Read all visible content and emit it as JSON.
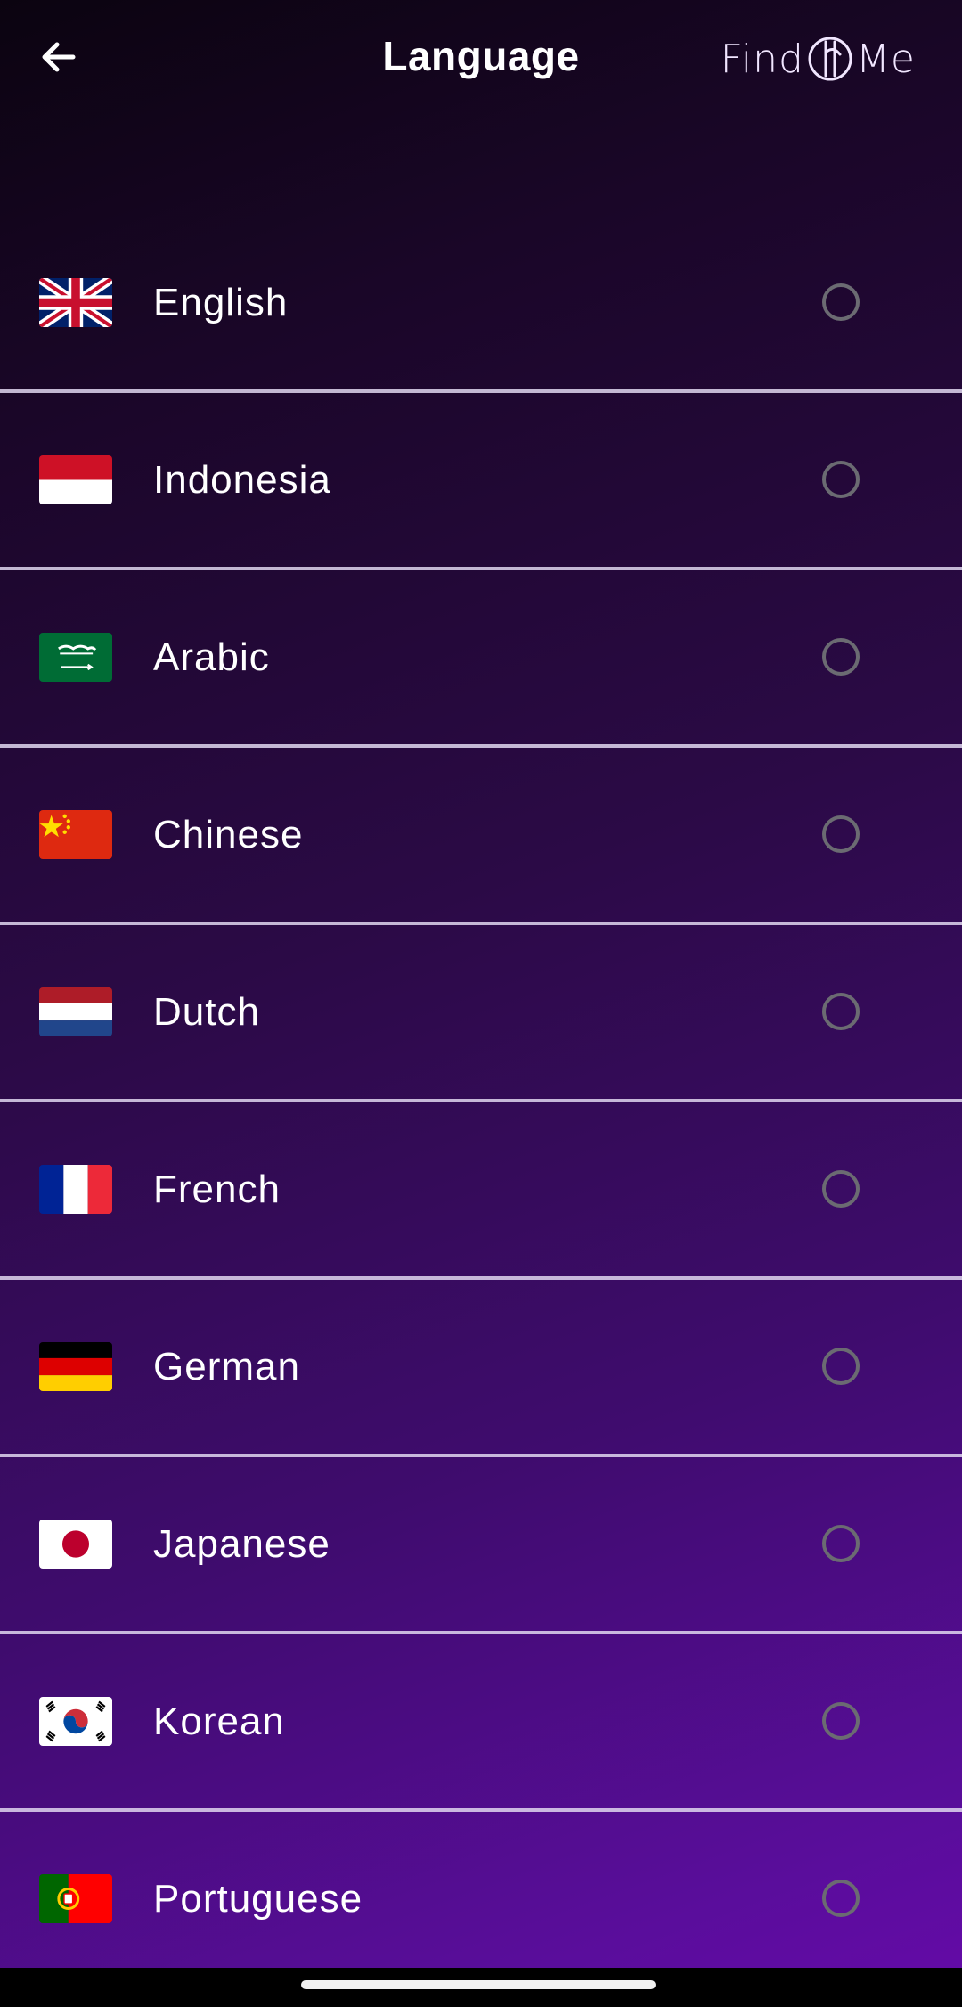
{
  "header": {
    "back_icon": "arrow-left-icon",
    "title": "Language",
    "logo": {
      "text_left": "Find",
      "text_right": "Me",
      "mark_icon": "findme-logo-mark"
    }
  },
  "languages": [
    {
      "label": "English",
      "flag": "uk-flag-icon",
      "selected": false
    },
    {
      "label": "Indonesia",
      "flag": "indonesia-flag-icon",
      "selected": false
    },
    {
      "label": "Arabic",
      "flag": "saudi-arabia-flag-icon",
      "selected": false
    },
    {
      "label": "Chinese",
      "flag": "china-flag-icon",
      "selected": false
    },
    {
      "label": "Dutch",
      "flag": "netherlands-flag-icon",
      "selected": false
    },
    {
      "label": "French",
      "flag": "france-flag-icon",
      "selected": false
    },
    {
      "label": "German",
      "flag": "germany-flag-icon",
      "selected": false
    },
    {
      "label": "Japanese",
      "flag": "japan-flag-icon",
      "selected": false
    },
    {
      "label": "Korean",
      "flag": "south-korea-flag-icon",
      "selected": false
    },
    {
      "label": "Portuguese",
      "flag": "portugal-flag-icon",
      "selected": false
    }
  ],
  "colors": {
    "background_top": "#0b0410",
    "background_bottom": "#650aa8",
    "divider": "#e1d7f0",
    "radio_border": "#6b6b72",
    "text": "#ffffff"
  }
}
